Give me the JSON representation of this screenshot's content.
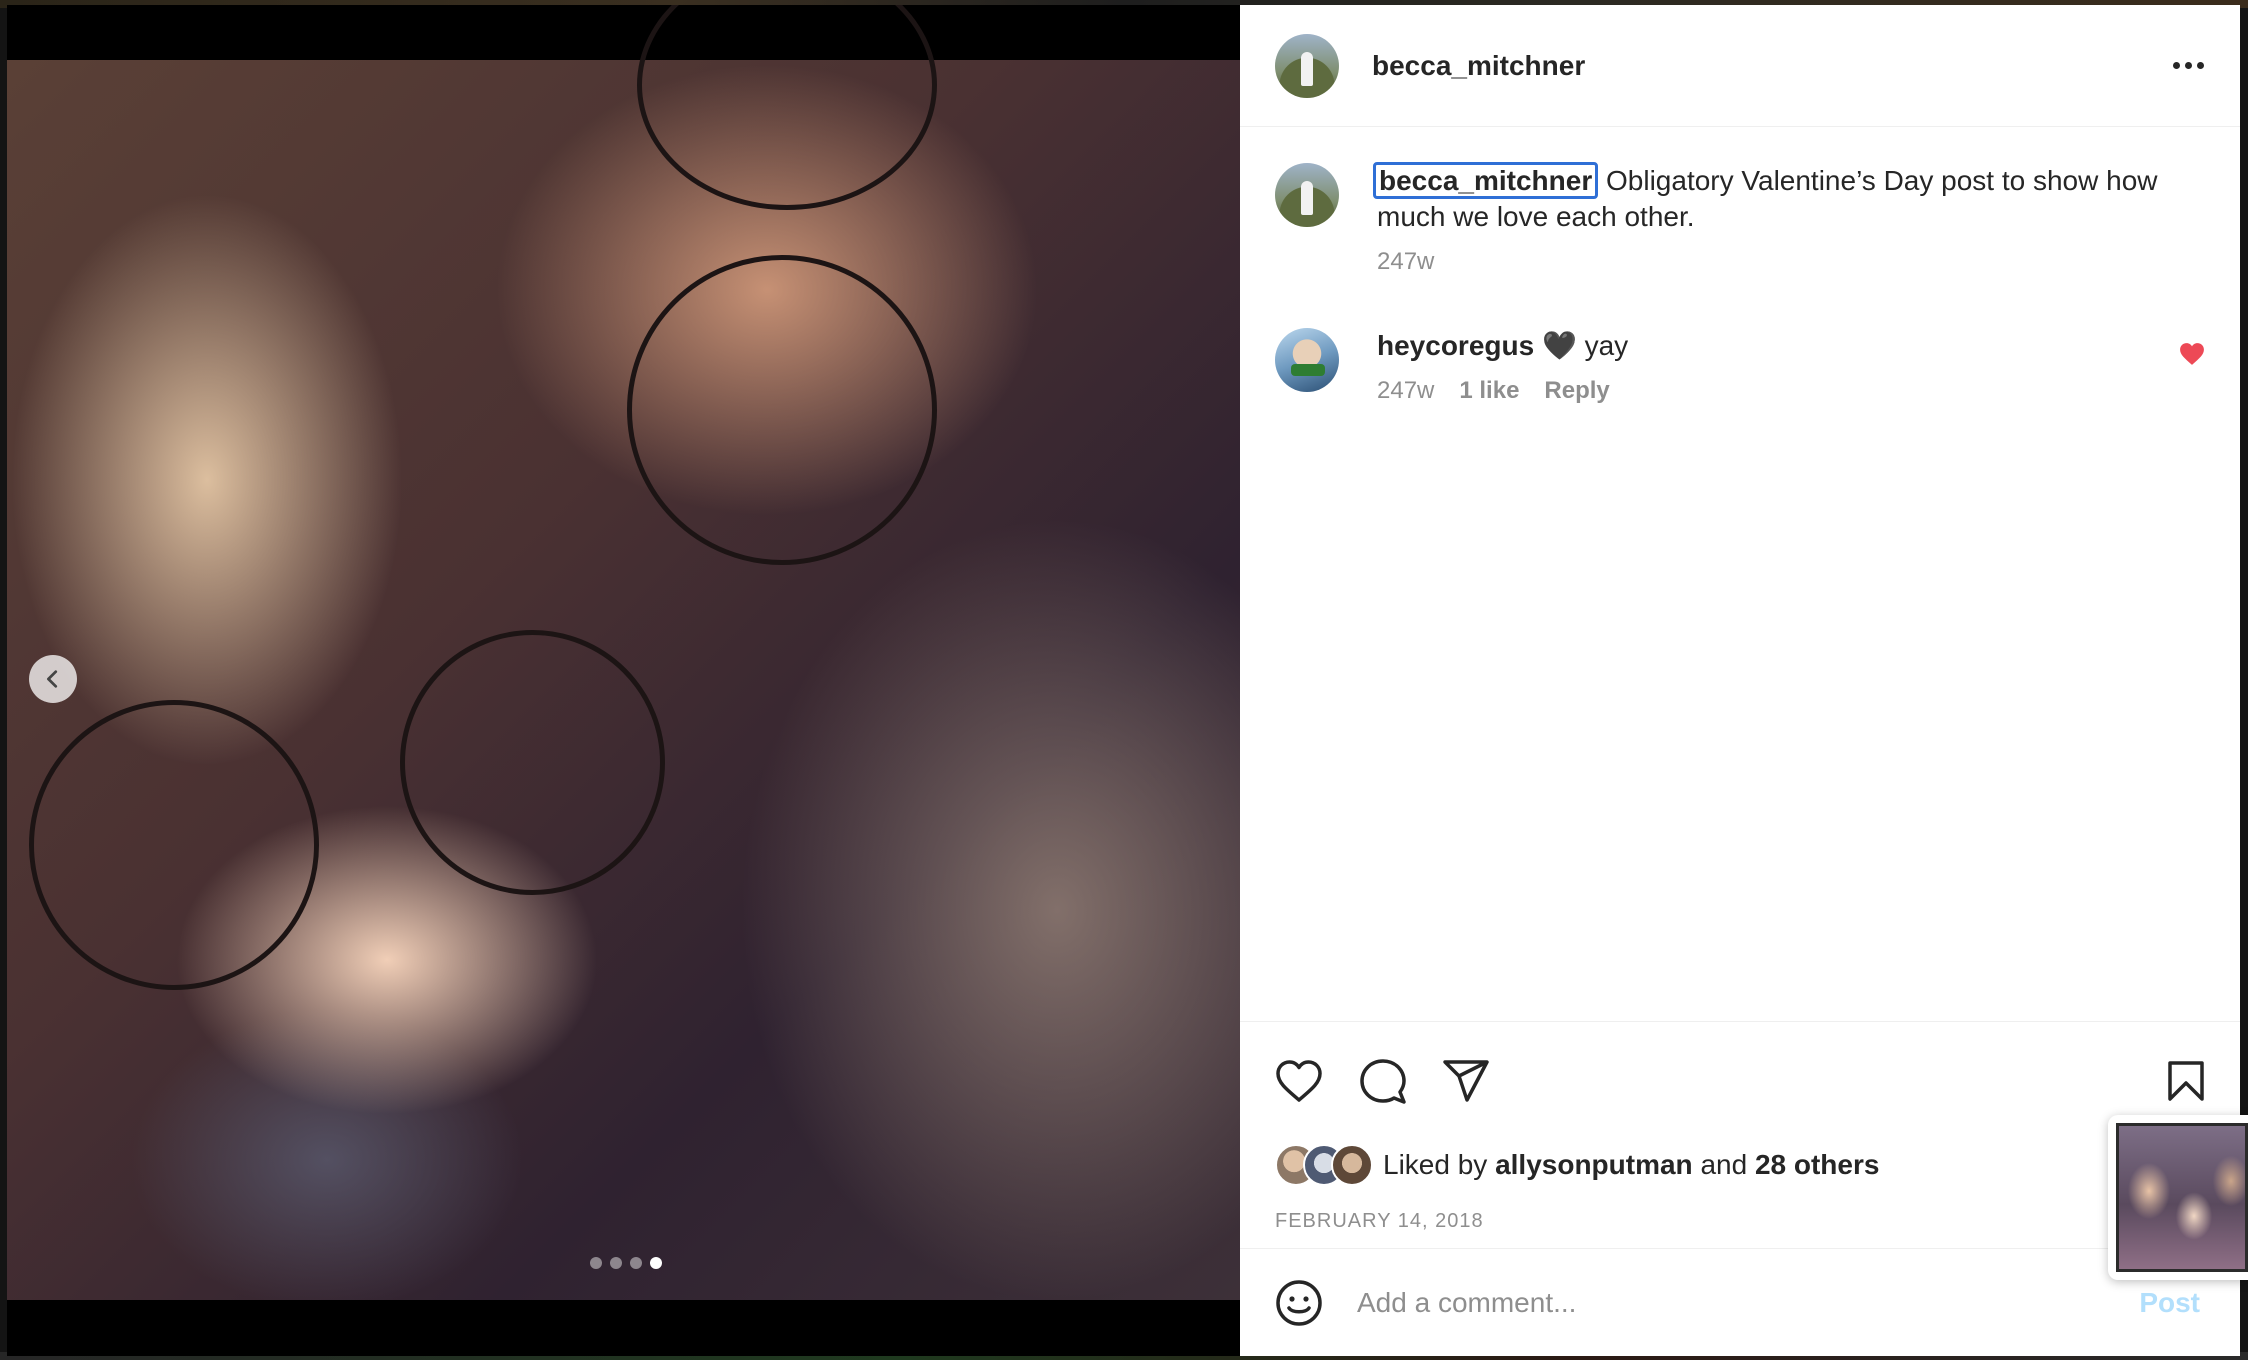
{
  "post": {
    "author": "becca_mitchner",
    "caption_author": "becca_mitchner",
    "caption": "Obligatory Valentine’s Day post to show how much we love each other.",
    "caption_time": "247w",
    "comments": [
      {
        "user": "heycoregus",
        "text": "🖤 yay",
        "time": "247w",
        "likes": "1 like",
        "reply": "Reply"
      }
    ],
    "likes": {
      "prefix": "Liked by",
      "user": "allysonputman",
      "and": "and",
      "others": "28 others"
    },
    "date": "FEBRUARY 14, 2018",
    "add_comment_placeholder": "Add a comment...",
    "post_button": "Post"
  },
  "carousel": {
    "slide_count": 4,
    "active_slide": 4
  },
  "colors": {
    "heart_red": "#ed4956",
    "mention_outline": "#2f6fd6",
    "post_disabled": "#b2dffc"
  },
  "icons": [
    "more-icon",
    "chevron-left-icon",
    "heart-icon",
    "comment-icon",
    "share-icon",
    "bookmark-icon",
    "emoji-icon"
  ]
}
